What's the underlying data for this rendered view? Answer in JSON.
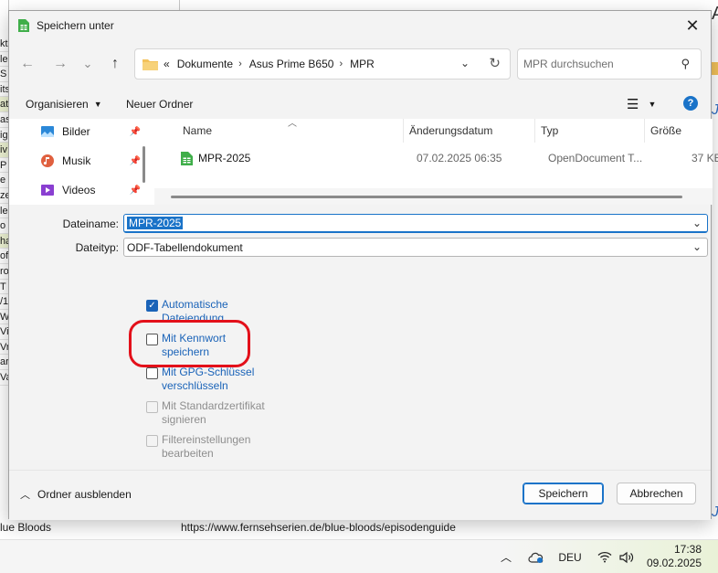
{
  "background": {
    "left_column": [
      "kt",
      "le",
      "S",
      "its",
      "at",
      "as",
      "ig",
      "iv",
      "P",
      "e",
      "ze",
      "le",
      "o",
      "ha",
      "of",
      "ro",
      "T",
      "/1",
      "Wh",
      "Vi",
      "Vri",
      "ar",
      "Va"
    ],
    "bottom_left_1": "er",
    "bottom_left_2": "lue Bloods",
    "bottom_url": "https://www.fernsehserien.de/blue-bloods/episodenguide",
    "right_letter": "A"
  },
  "dialog": {
    "title": "Speichern unter",
    "close_label": "✕",
    "nav": {
      "back": "←",
      "forward": "→",
      "recent": "⌄",
      "up": "↑",
      "breadcrumb_overflow": "«",
      "breadcrumbs": [
        "Dokumente",
        "Asus Prime B650",
        "MPR"
      ],
      "breadcrumb_sep": "›",
      "search_placeholder": "MPR durchsuchen"
    },
    "toolbar": {
      "organize": "Organisieren",
      "new_folder": "Neuer Ordner"
    },
    "sidebar": [
      {
        "label": "Bilder",
        "icon": "pictures-icon"
      },
      {
        "label": "Musik",
        "icon": "music-icon"
      },
      {
        "label": "Videos",
        "icon": "videos-icon"
      }
    ],
    "columns": {
      "name": "Name",
      "date": "Änderungsdatum",
      "type": "Typ",
      "size": "Größe"
    },
    "files": [
      {
        "name": "MPR-2025",
        "date": "07.02.2025 06:35",
        "type": "OpenDocument T...",
        "size": "37 KB"
      }
    ],
    "form": {
      "filename_label": "Dateiname:",
      "filename_value": "MPR-2025",
      "filetype_label": "Dateityp:",
      "filetype_value": "ODF-Tabellendokument"
    },
    "options": [
      {
        "label_1": "Automatische",
        "label_2": "Dateiendung",
        "checked": true,
        "disabled": false
      },
      {
        "label_1": "Mit Kennwort",
        "label_2": "speichern",
        "checked": false,
        "disabled": false
      },
      {
        "label_1": "Mit GPG-Schlüssel",
        "label_2": "verschlüsseln",
        "checked": false,
        "disabled": false
      },
      {
        "label_1": "Mit Standardzertifikat",
        "label_2": "signieren",
        "checked": false,
        "disabled": true
      },
      {
        "label_1": "Filtereinstellungen",
        "label_2": "bearbeiten",
        "checked": false,
        "disabled": true
      }
    ],
    "footer": {
      "hide_folders": "Ordner ausblenden",
      "save": "Speichern",
      "cancel": "Abbrechen"
    }
  },
  "taskbar": {
    "language": "DEU",
    "time": "17:38",
    "date": "09.02.2025"
  },
  "colors": {
    "accent": "#1a73c8",
    "annotation_circle": "#e3101a",
    "calc_green": "#3fae49"
  }
}
